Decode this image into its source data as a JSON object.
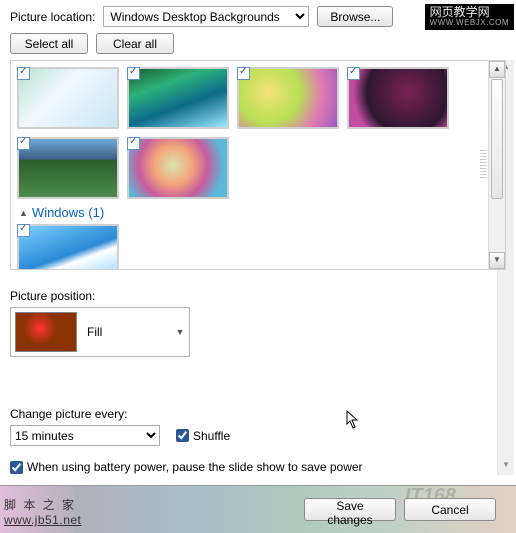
{
  "watermarks": {
    "top_right_line1": "网页教学网",
    "top_right_line2": "WWW.WEBJX.COM",
    "bottom_left_line1": "脚 本 之 家",
    "bottom_left_line2": "www.jb51.net",
    "bottom_right": "IT168"
  },
  "header": {
    "location_label": "Picture location:",
    "location_value": "Windows Desktop Backgrounds",
    "browse_label": "Browse..."
  },
  "select_buttons": {
    "select_all": "Select all",
    "clear_all": "Clear all"
  },
  "gallery": {
    "thumbs_checked": [
      true,
      true,
      true,
      true,
      true,
      true,
      true
    ],
    "category_label": "Windows (1)"
  },
  "position": {
    "label": "Picture position:",
    "value": "Fill"
  },
  "interval": {
    "label": "Change picture every:",
    "value": "15 minutes",
    "shuffle_label": "Shuffle",
    "shuffle_checked": true
  },
  "battery": {
    "label": "When using battery power, pause the slide show to save power",
    "checked": true
  },
  "footer": {
    "save": "Save changes",
    "cancel": "Cancel"
  }
}
